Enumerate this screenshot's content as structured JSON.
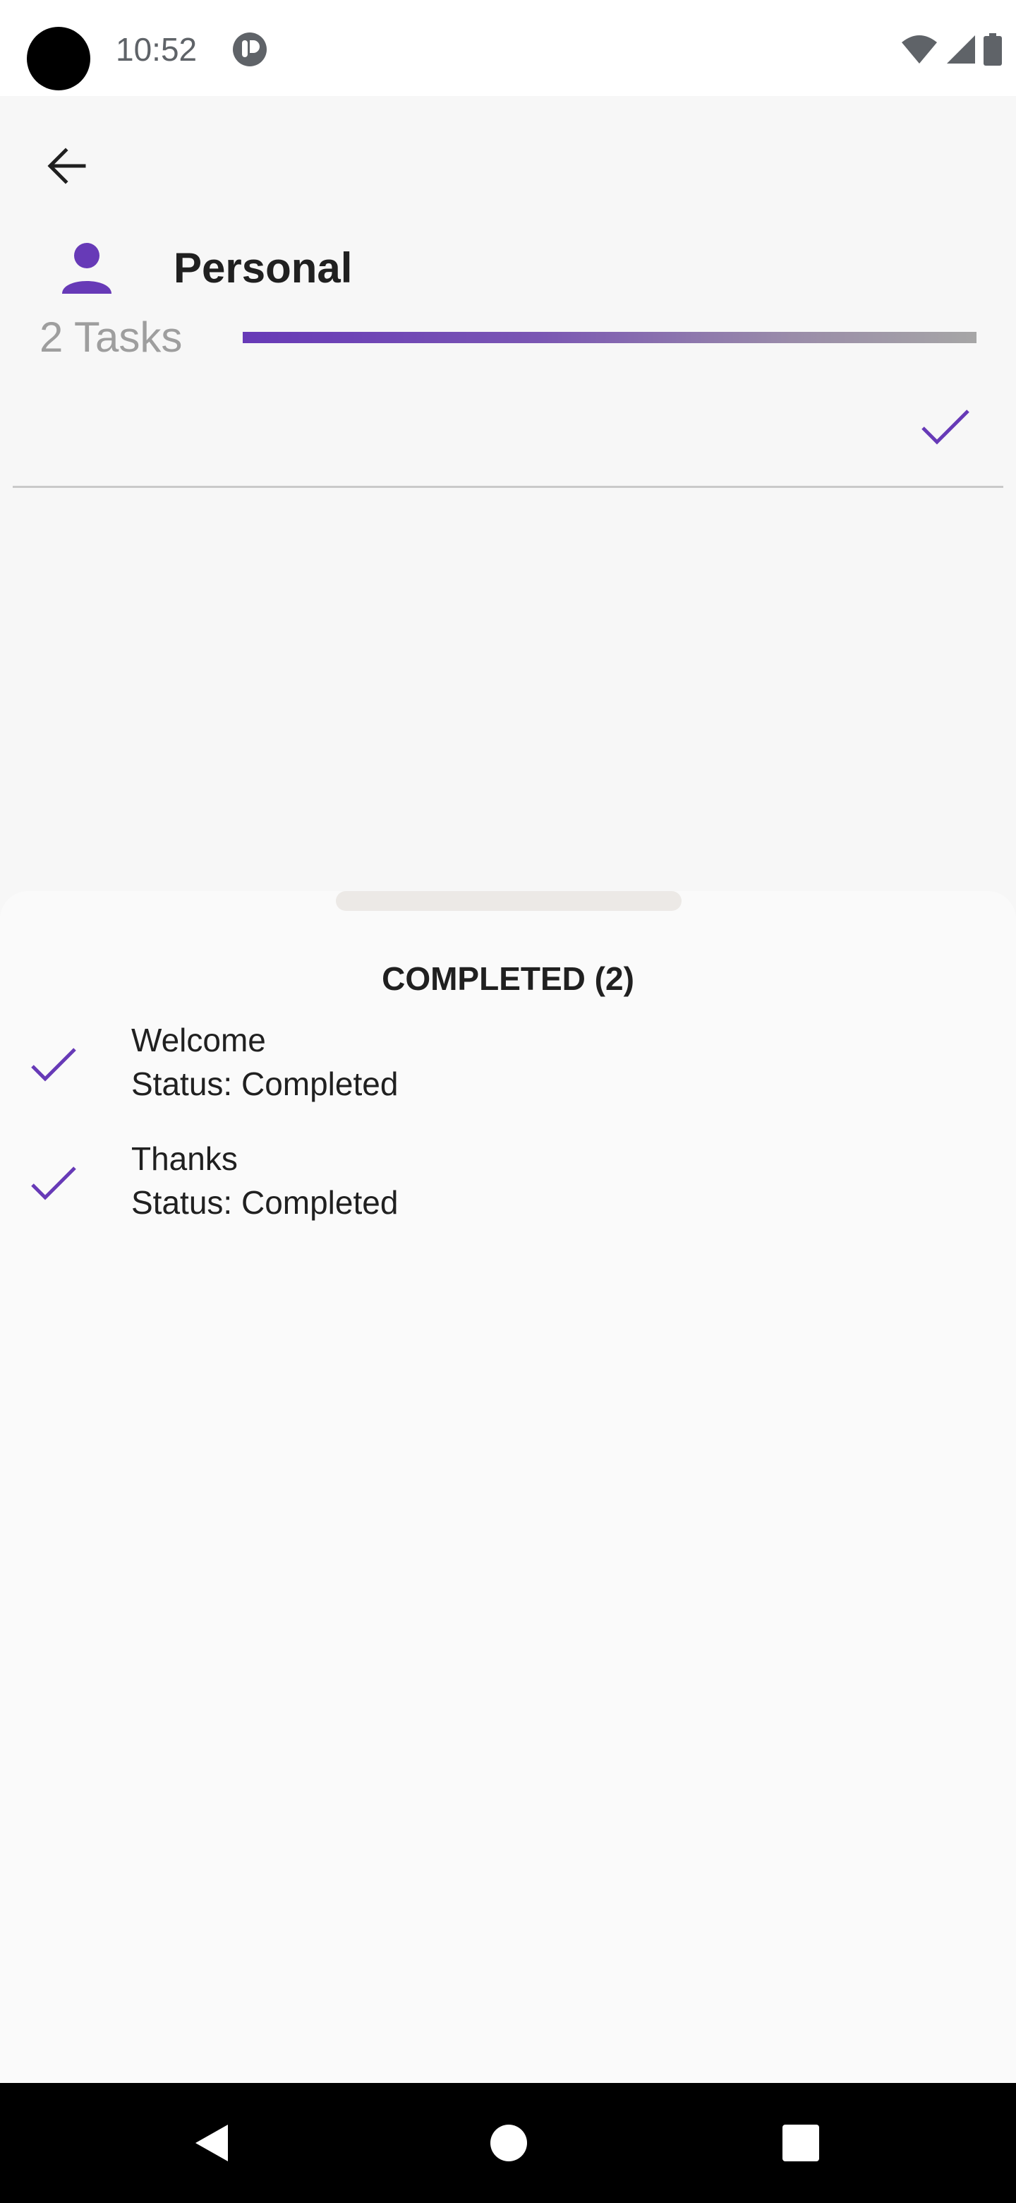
{
  "status_bar": {
    "time": "10:52",
    "icons": [
      "app-notification-icon",
      "wifi-icon",
      "cellular-signal-icon",
      "battery-icon"
    ]
  },
  "header": {
    "back_icon": "arrow-left-icon",
    "list_icon": "person-icon",
    "title": "Personal",
    "task_count": "2 Tasks",
    "progress": 1.0,
    "confirm_icon": "check-icon"
  },
  "sheet": {
    "section_title": "COMPLETED (2)",
    "tasks": [
      {
        "name": "Welcome",
        "status": "Status: Completed",
        "icon": "check-icon"
      },
      {
        "name": "Thanks",
        "status": "Status: Completed",
        "icon": "check-icon"
      }
    ]
  },
  "nav_bar": {
    "buttons": [
      "back-triangle-icon",
      "home-circle-icon",
      "recents-square-icon"
    ]
  },
  "colors": {
    "accent": "#673ab7",
    "text_primary": "#202020",
    "text_secondary": "#9e9e9e",
    "background": "#f7f7f7",
    "sheet_background": "#fafafa"
  }
}
